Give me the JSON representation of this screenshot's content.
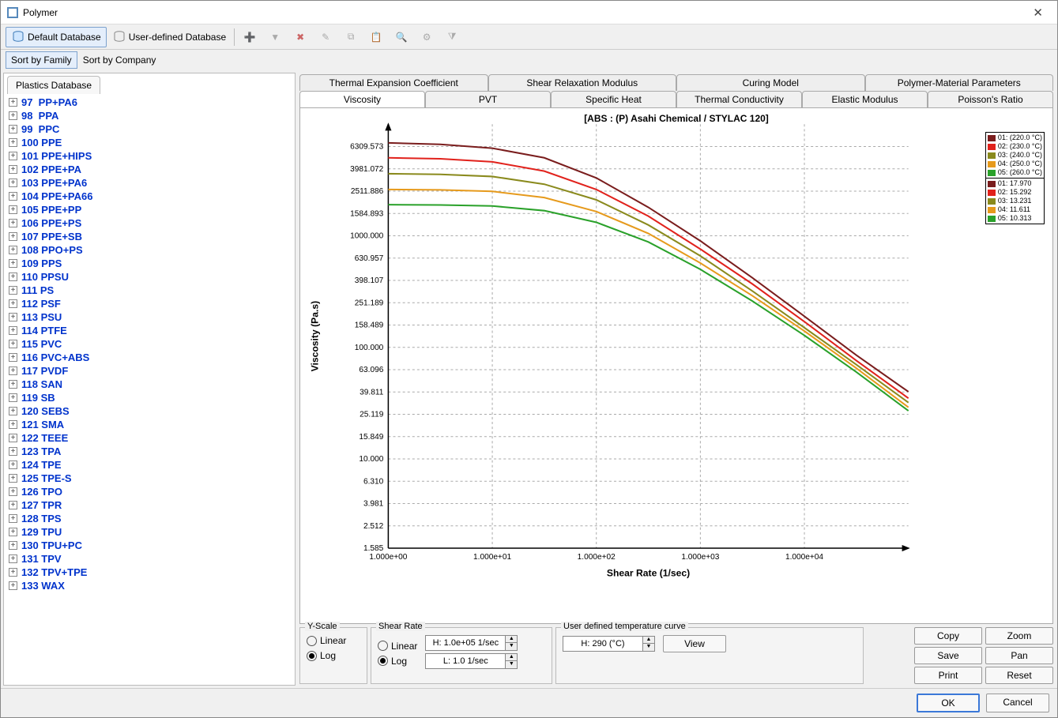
{
  "window": {
    "title": "Polymer"
  },
  "toolbar": {
    "default_db": "Default Database",
    "user_db": "User-defined Database"
  },
  "sortbar": {
    "by_family": "Sort by Family",
    "by_company": "Sort by Company"
  },
  "tree": {
    "tab_label": "Plastics Database",
    "items": [
      {
        "label": "97  PP+PA6"
      },
      {
        "label": "98  PPA"
      },
      {
        "label": "99  PPC"
      },
      {
        "label": "100 PPE"
      },
      {
        "label": "101 PPE+HIPS"
      },
      {
        "label": "102 PPE+PA"
      },
      {
        "label": "103 PPE+PA6"
      },
      {
        "label": "104 PPE+PA66"
      },
      {
        "label": "105 PPE+PP"
      },
      {
        "label": "106 PPE+PS"
      },
      {
        "label": "107 PPE+SB"
      },
      {
        "label": "108 PPO+PS"
      },
      {
        "label": "109 PPS"
      },
      {
        "label": "110 PPSU"
      },
      {
        "label": "111 PS"
      },
      {
        "label": "112 PSF"
      },
      {
        "label": "113 PSU"
      },
      {
        "label": "114 PTFE"
      },
      {
        "label": "115 PVC"
      },
      {
        "label": "116 PVC+ABS"
      },
      {
        "label": "117 PVDF"
      },
      {
        "label": "118 SAN"
      },
      {
        "label": "119 SB"
      },
      {
        "label": "120 SEBS"
      },
      {
        "label": "121 SMA"
      },
      {
        "label": "122 TEEE"
      },
      {
        "label": "123 TPA"
      },
      {
        "label": "124 TPE"
      },
      {
        "label": "125 TPE-S"
      },
      {
        "label": "126 TPO"
      },
      {
        "label": "127 TPR"
      },
      {
        "label": "128 TPS"
      },
      {
        "label": "129 TPU"
      },
      {
        "label": "130 TPU+PC"
      },
      {
        "label": "131 TPV"
      },
      {
        "label": "132 TPV+TPE"
      },
      {
        "label": "133 WAX"
      }
    ]
  },
  "tabs": {
    "row1": [
      "Thermal Expansion Coefficient",
      "Shear Relaxation Modulus",
      "Curing Model",
      "Polymer-Material Parameters"
    ],
    "row2": [
      "Viscosity",
      "PVT",
      "Specific Heat",
      "Thermal Conductivity",
      "Elastic Modulus",
      "Poisson's Ratio"
    ],
    "active": "Viscosity"
  },
  "chart_data": {
    "type": "line",
    "title": "[ABS : (P)  Asahi Chemical / STYLAC 120]",
    "xlabel": "Shear Rate (1/sec)",
    "ylabel": "Viscosity (Pa.s)",
    "x_scale": "log",
    "y_scale": "log",
    "x_ticks": [
      "1.000e+00",
      "1.000e+01",
      "1.000e+02",
      "1.000e+03",
      "1.000e+04"
    ],
    "y_ticks": [
      "6309.573",
      "3981.072",
      "2511.886",
      "1584.893",
      "1000.000",
      "630.957",
      "398.107",
      "251.189",
      "158.489",
      "100.000",
      "63.096",
      "39.811",
      "25.119",
      "15.849",
      "10.000",
      "6.310",
      "3.981",
      "2.512",
      "1.585"
    ],
    "x": [
      1,
      3.16,
      10,
      31.6,
      100,
      316,
      1000,
      3162,
      10000,
      31623,
      100000
    ],
    "series": [
      {
        "name": "01: (220.0 °C)",
        "color": "#7a1d1d",
        "values": [
          6800,
          6600,
          6100,
          5000,
          3300,
          1800,
          900,
          420,
          190,
          85,
          40
        ],
        "legend2": "01: 17.970"
      },
      {
        "name": "02: (230.0 °C)",
        "color": "#e1221c",
        "values": [
          5000,
          4900,
          4600,
          3800,
          2600,
          1500,
          760,
          370,
          170,
          76,
          35
        ],
        "legend2": "02: 15.292"
      },
      {
        "name": "03: (240.0 °C)",
        "color": "#8a8a1d",
        "values": [
          3600,
          3550,
          3400,
          2900,
          2100,
          1250,
          660,
          320,
          150,
          70,
          32
        ],
        "legend2": "03: 13.231"
      },
      {
        "name": "04: (250.0 °C)",
        "color": "#e69a1c",
        "values": [
          2600,
          2580,
          2500,
          2200,
          1650,
          1050,
          570,
          290,
          140,
          65,
          29
        ],
        "legend2": "04: 11.611"
      },
      {
        "name": "05: (260.0 °C)",
        "color": "#2aa12a",
        "values": [
          1900,
          1890,
          1850,
          1680,
          1320,
          880,
          500,
          260,
          128,
          60,
          27
        ],
        "legend2": "05: 10.313"
      }
    ]
  },
  "controls": {
    "yscale_label": "Y-Scale",
    "linear": "Linear",
    "log": "Log",
    "shear_label": "Shear Rate",
    "shear_high": "H: 1.0e+05 1/sec",
    "shear_low": "L: 1.0 1/sec",
    "user_temp_label": "User defined temperature curve",
    "user_temp_val": "H: 290 (°C)",
    "view": "View",
    "copy": "Copy",
    "zoom": "Zoom",
    "save": "Save",
    "pan": "Pan",
    "print": "Print",
    "reset": "Reset"
  },
  "footer": {
    "ok": "OK",
    "cancel": "Cancel"
  }
}
